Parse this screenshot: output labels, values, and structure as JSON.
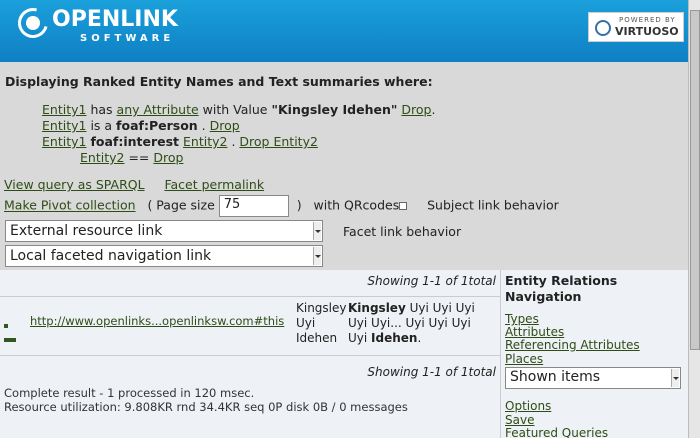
{
  "header": {
    "logo_main": "OPENLINK",
    "logo_sub": "SOFTWARE",
    "badge_top": "POWERED BY",
    "badge_main": "VIRTUOSO"
  },
  "query": {
    "heading": "Displaying Ranked Entity Names and Text summaries where:",
    "c1": {
      "entity": "Entity1",
      "has": "has",
      "attr": "any Attribute",
      "with": "with Value",
      "value": "\"Kingsley Idehen\"",
      "drop": "Drop",
      "end": "."
    },
    "c2": {
      "entity": "Entity1",
      "isa": "is a",
      "type": "foaf:Person",
      "dot": ".",
      "drop": "Drop"
    },
    "c3": {
      "entity": "Entity1",
      "pred": "foaf:interest",
      "obj": "Entity2",
      "dot": ".",
      "drop": "Drop Entity2"
    },
    "c4": {
      "entity": "Entity2",
      "eq": "==",
      "drop": "Drop"
    }
  },
  "controls": {
    "view_sparql": "View query as SPARQL",
    "facet_permalink": "Facet permalink",
    "make_pivot": "Make Pivot collection",
    "page_size_open": "( Page size",
    "page_size_value": "75",
    "page_size_close": ")",
    "with_qr": "with QRcodes",
    "subject_link_behavior": "Subject link behavior",
    "subject_select": "External resource link",
    "facet_link_behavior": "Facet link behavior",
    "facet_select": "Local faceted navigation link"
  },
  "results": {
    "showing_top": "Showing 1-1 of 1total",
    "link": "http://www.openlinks...openlinksw.com#this",
    "name_lines": [
      "Kingsley",
      "Uyi",
      "Idehen"
    ],
    "summary": {
      "l1_bold": "Kingsley",
      "l1_rest": " Uyi Uyi Uyi",
      "l2": "Uyi Uyi... Uyi Uyi Uyi",
      "l3_pre": "Uyi ",
      "l3_bold": "Idehen",
      "l3_post": "."
    },
    "showing_bottom": "Showing 1-1 of 1total",
    "status1": "Complete result - 1 processed in 120 msec.",
    "status2": "Resource utilization: 9.808KR rnd 34.4KR seq 0P disk 0B / 0 messages"
  },
  "sidebar": {
    "title_line1": "Entity Relations",
    "title_line2": "Navigation",
    "types": "Types",
    "attributes": "Attributes",
    "referencing": "Referencing Attributes",
    "places": "Places",
    "select": "Shown items",
    "options": "Options",
    "save": "Save",
    "featured": "Featured Queries"
  }
}
